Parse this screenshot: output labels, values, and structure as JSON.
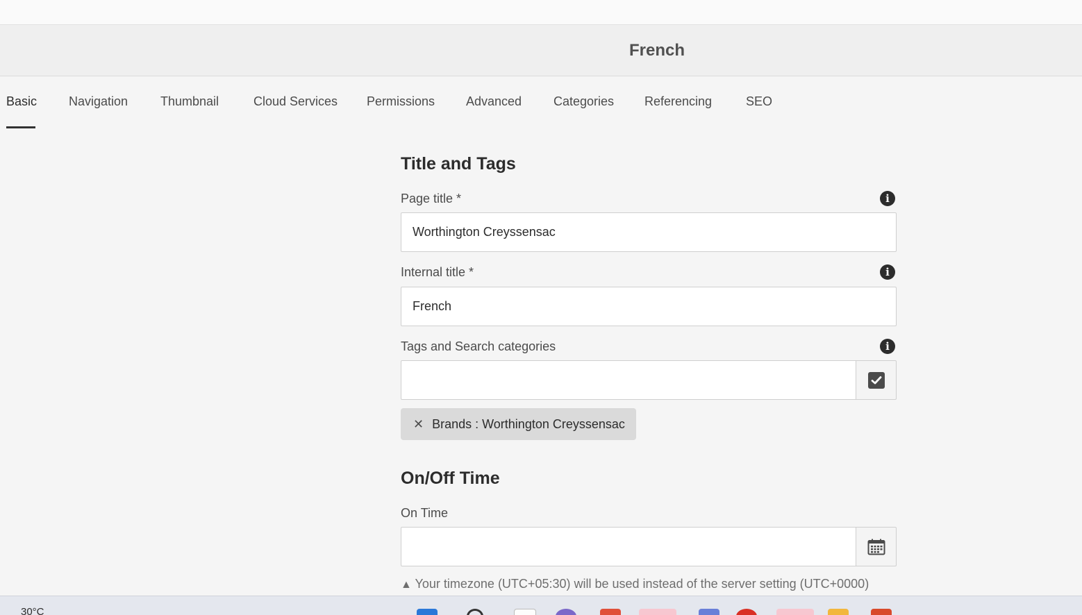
{
  "page": {
    "title": "French"
  },
  "tabs": [
    {
      "label": "Basic",
      "active": true
    },
    {
      "label": "Navigation"
    },
    {
      "label": "Thumbnail"
    },
    {
      "label": "Cloud Services"
    },
    {
      "label": "Permissions"
    },
    {
      "label": "Advanced"
    },
    {
      "label": "Categories"
    },
    {
      "label": "Referencing"
    },
    {
      "label": "SEO"
    }
  ],
  "title_tags": {
    "heading": "Title and Tags",
    "page_title": {
      "label": "Page title *",
      "value": "Worthington Creyssensac"
    },
    "internal_title": {
      "label": "Internal title *",
      "value": "French"
    },
    "tags": {
      "label": "Tags and Search categories",
      "value": "",
      "chips": [
        {
          "label": "Brands : Worthington Creyssensac"
        }
      ]
    }
  },
  "on_off_time": {
    "heading": "On/Off Time",
    "on_time": {
      "label": "On Time",
      "value": ""
    },
    "timezone_note": "Your timezone (UTC+05:30) will be used instead of the server setting (UTC+0000)"
  },
  "icons": {
    "info": "info-icon",
    "check": "checkbox-check-icon",
    "calendar": "calendar-icon",
    "remove": "close-icon",
    "warning": "warning-icon"
  },
  "taskbar": {
    "weather": "30°C"
  },
  "colors": {
    "background": "#f5f5f5",
    "text": "#2c2c2c",
    "active_tab_underline": "#323232",
    "chip": "#dadada"
  }
}
